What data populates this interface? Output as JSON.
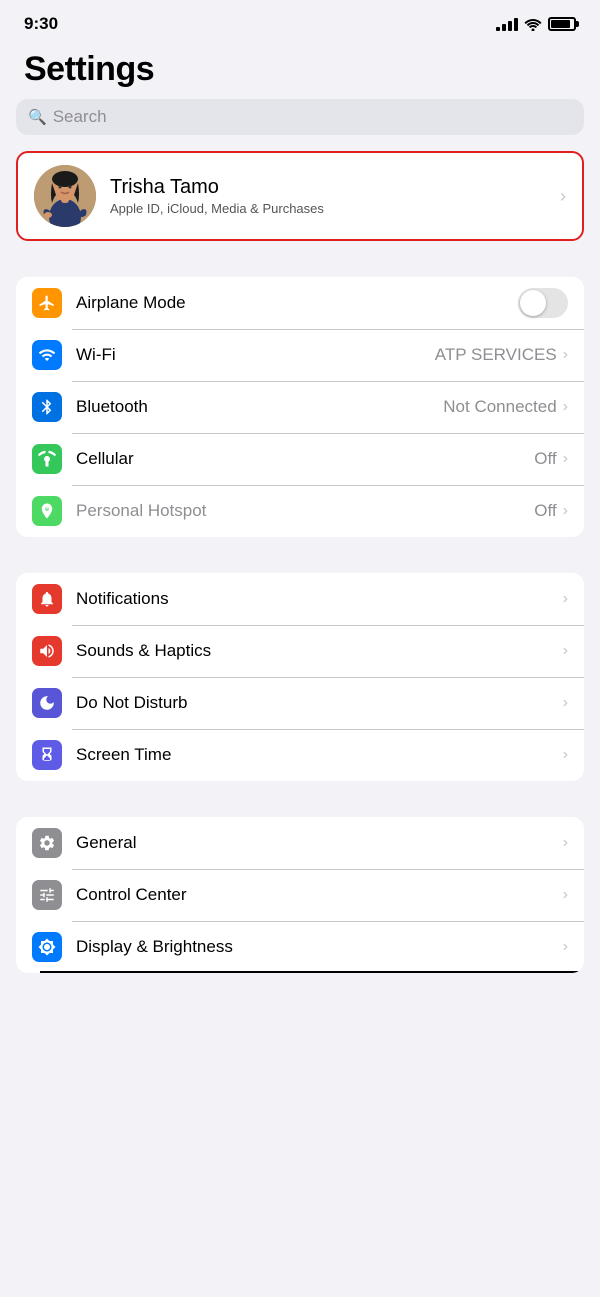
{
  "statusBar": {
    "time": "9:30",
    "signal": "signal-icon",
    "wifi": "wifi-icon",
    "battery": "battery-icon"
  },
  "header": {
    "title": "Settings"
  },
  "search": {
    "placeholder": "Search"
  },
  "profile": {
    "name": "Trisha Tamo",
    "subtitle": "Apple ID, iCloud, Media & Purchases",
    "chevron": "›"
  },
  "connectivity": [
    {
      "id": "airplane-mode",
      "icon": "airplane-icon",
      "iconColor": "icon-orange",
      "label": "Airplane Mode",
      "valueType": "toggle",
      "toggleOn": false
    },
    {
      "id": "wifi",
      "icon": "wifi-settings-icon",
      "iconColor": "icon-blue",
      "label": "Wi-Fi",
      "value": "ATP SERVICES",
      "valueType": "text-chevron"
    },
    {
      "id": "bluetooth",
      "icon": "bluetooth-icon",
      "iconColor": "icon-blue-dark",
      "label": "Bluetooth",
      "value": "Not Connected",
      "valueType": "text-chevron"
    },
    {
      "id": "cellular",
      "icon": "cellular-icon",
      "iconColor": "icon-green",
      "label": "Cellular",
      "value": "Off",
      "valueType": "text-chevron"
    },
    {
      "id": "personal-hotspot",
      "icon": "hotspot-icon",
      "iconColor": "icon-green-light",
      "label": "Personal Hotspot",
      "value": "Off",
      "valueType": "text-chevron",
      "labelDimmed": true
    }
  ],
  "notifications": [
    {
      "id": "notifications",
      "icon": "bell-icon",
      "iconColor": "icon-red-notif",
      "label": "Notifications",
      "valueType": "chevron"
    },
    {
      "id": "sounds-haptics",
      "icon": "sound-icon",
      "iconColor": "icon-pink-red",
      "label": "Sounds & Haptics",
      "valueType": "chevron"
    },
    {
      "id": "do-not-disturb",
      "icon": "moon-icon",
      "iconColor": "icon-purple",
      "label": "Do Not Disturb",
      "valueType": "chevron"
    },
    {
      "id": "screen-time",
      "icon": "hourglass-icon",
      "iconColor": "icon-purple-dark",
      "label": "Screen Time",
      "valueType": "chevron"
    }
  ],
  "system": [
    {
      "id": "general",
      "icon": "gear-icon",
      "iconColor": "icon-gray",
      "label": "General",
      "valueType": "chevron"
    },
    {
      "id": "control-center",
      "icon": "sliders-icon",
      "iconColor": "icon-gray",
      "label": "Control Center",
      "valueType": "chevron"
    },
    {
      "id": "display-brightness",
      "icon": "display-icon",
      "iconColor": "icon-blue",
      "label": "Display & Brightness",
      "valueType": "chevron",
      "underline": true
    }
  ]
}
